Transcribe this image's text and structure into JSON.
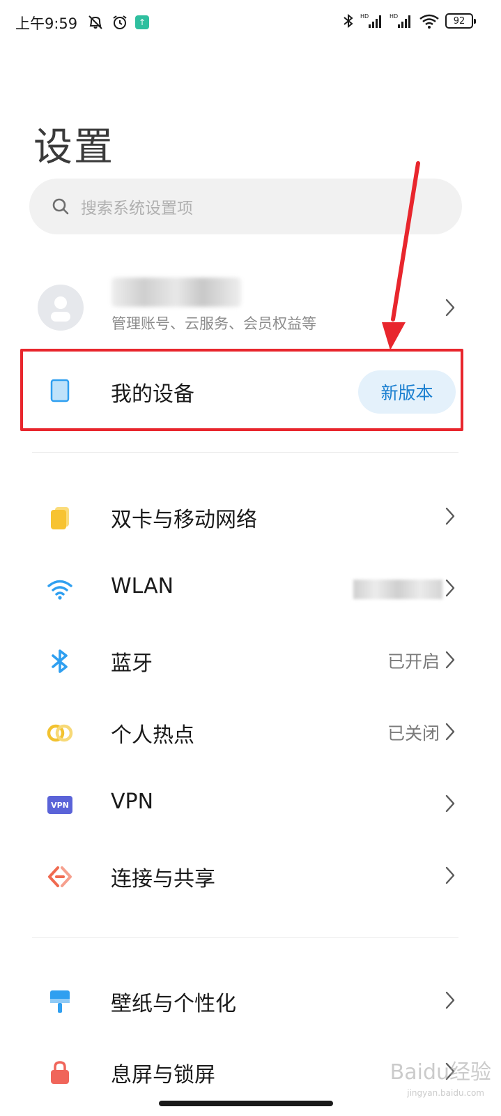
{
  "status_bar": {
    "time": "上午9:59",
    "battery": "92",
    "icons": [
      "bell-muted-icon",
      "alarm-icon",
      "app-notification-icon",
      "bluetooth-icon",
      "hd-signal-icon",
      "hd-signal-icon",
      "wifi-icon",
      "battery-icon"
    ]
  },
  "page": {
    "title": "设置"
  },
  "search": {
    "placeholder": "搜索系统设置项"
  },
  "account": {
    "subtitle": "管理账号、云服务、会员权益等"
  },
  "device": {
    "label": "我的设备",
    "badge": "新版本"
  },
  "section1": [
    {
      "label": "双卡与移动网络",
      "value": "",
      "icon": "sim-card-icon",
      "color": "#f7c332"
    },
    {
      "label": "WLAN",
      "value": "",
      "icon": "wifi-icon",
      "color": "#2f9ff0"
    },
    {
      "label": "蓝牙",
      "value": "已开启",
      "icon": "bluetooth-icon",
      "color": "#2f9ff0"
    },
    {
      "label": "个人热点",
      "value": "已关闭",
      "icon": "hotspot-icon",
      "color": "#f2c230"
    },
    {
      "label": "VPN",
      "value": "",
      "icon": "vpn-icon",
      "color": "#5a63d8"
    },
    {
      "label": "连接与共享",
      "value": "",
      "icon": "connection-share-icon",
      "color": "#f06a50"
    }
  ],
  "section2": [
    {
      "label": "壁纸与个性化",
      "value": "",
      "icon": "wallpaper-icon",
      "color": "#2f9ff0"
    },
    {
      "label": "息屏与锁屏",
      "value": "",
      "icon": "lock-icon",
      "color": "#f0655a"
    }
  ],
  "vpn_icon_text": "VPN",
  "watermark": {
    "text": "Baidu经验",
    "sub": "jingyan.baidu.com"
  },
  "colors": {
    "highlight": "#e8262d",
    "accent": "#1a7fd0",
    "badge_bg": "#e4f1fb"
  }
}
